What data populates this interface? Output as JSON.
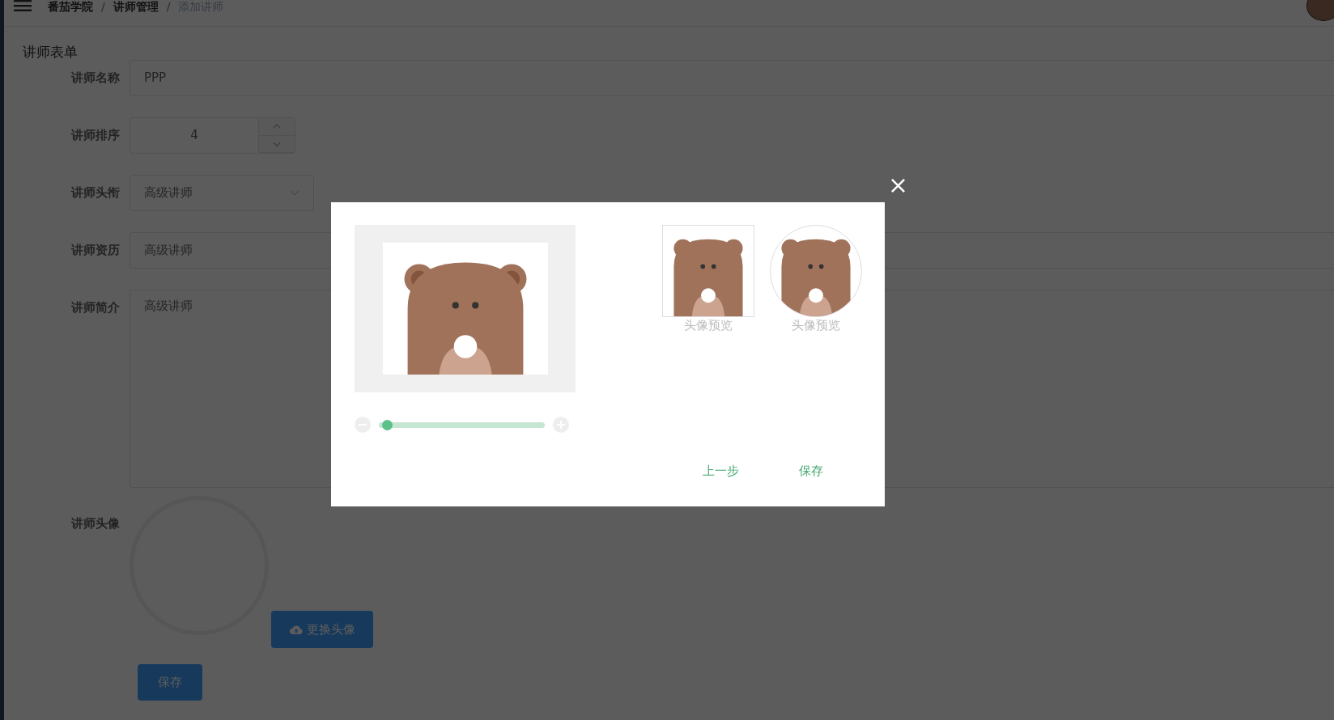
{
  "breadcrumb": [
    {
      "label": "番茄学院",
      "selected": false
    },
    {
      "label": "讲师管理",
      "selected": false
    },
    {
      "label": "添加讲师",
      "selected": true
    }
  ],
  "breadcrumb_separator": "/",
  "form": {
    "title": "讲师表单",
    "fields": [
      {
        "kind": "text",
        "label": "讲师名称",
        "value": "PPP"
      },
      {
        "kind": "number",
        "label": "讲师排序",
        "value": "4"
      },
      {
        "kind": "select",
        "label": "讲师头衔",
        "value": "高级讲师"
      },
      {
        "kind": "text",
        "label": "讲师资历",
        "value": "高级讲师"
      },
      {
        "kind": "textarea",
        "label": "讲师简介",
        "value": "高级讲师"
      }
    ],
    "avatar": {
      "label": "讲师头像",
      "button": "更换头像"
    },
    "save_button": "保存"
  },
  "dialog": {
    "zoom_slider": {
      "level": 0.03
    },
    "previews": [
      {
        "kind": "square",
        "caption": "头像预览"
      },
      {
        "kind": "circle",
        "caption": "头像预览"
      }
    ],
    "buttons": [
      "上一步",
      "保存"
    ]
  }
}
